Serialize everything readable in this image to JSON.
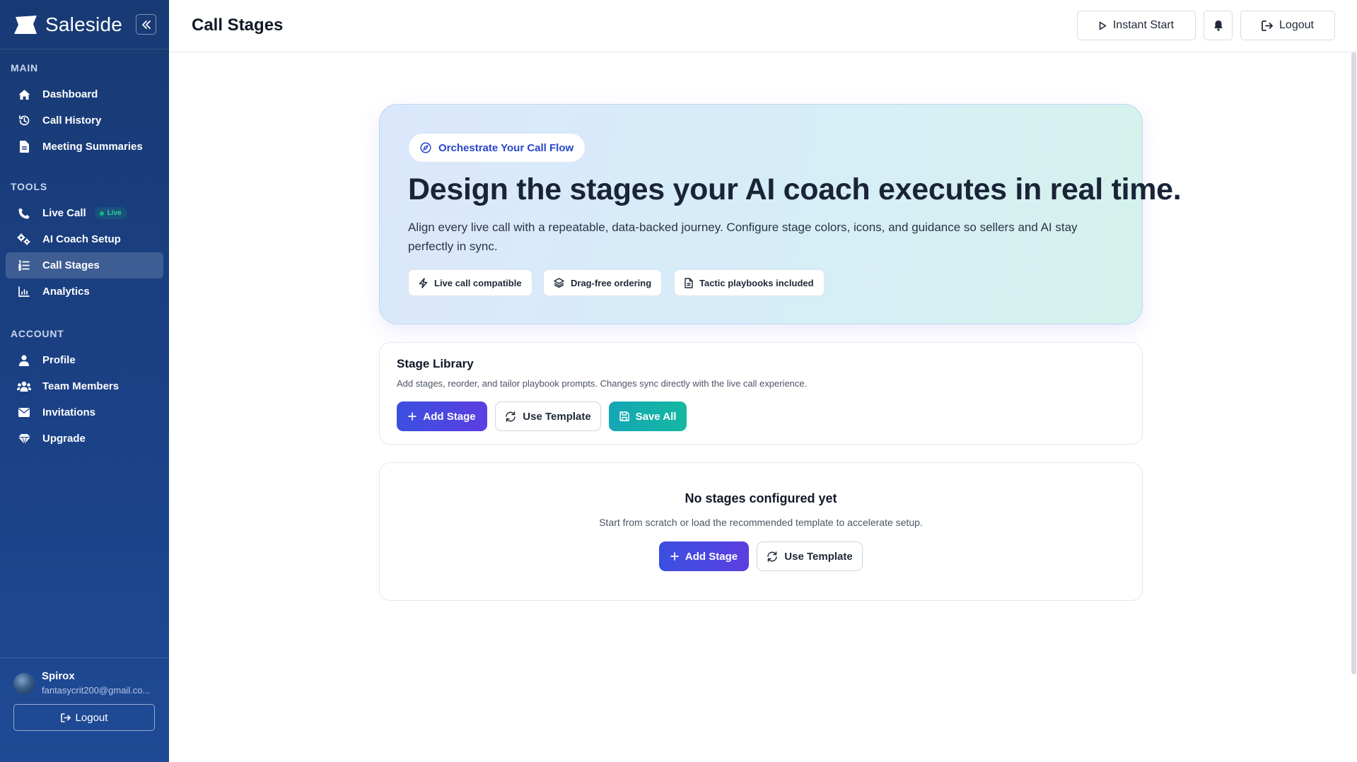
{
  "app": {
    "name": "Saleside"
  },
  "sidebar": {
    "sections": [
      {
        "label": "MAIN",
        "items": [
          {
            "label": "Dashboard",
            "icon": "home-icon"
          },
          {
            "label": "Call History",
            "icon": "history-icon"
          },
          {
            "label": "Meeting Summaries",
            "icon": "document-icon"
          }
        ]
      },
      {
        "label": "TOOLS",
        "items": [
          {
            "label": "Live Call",
            "icon": "phone-icon",
            "badge": "Live"
          },
          {
            "label": "AI Coach Setup",
            "icon": "gears-icon"
          },
          {
            "label": "Call Stages",
            "icon": "list-ordered-icon",
            "active": true
          },
          {
            "label": "Analytics",
            "icon": "chart-icon"
          }
        ]
      },
      {
        "label": "ACCOUNT",
        "items": [
          {
            "label": "Profile",
            "icon": "user-icon"
          },
          {
            "label": "Team Members",
            "icon": "users-icon"
          },
          {
            "label": "Invitations",
            "icon": "envelope-icon"
          },
          {
            "label": "Upgrade",
            "icon": "gem-icon"
          }
        ]
      }
    ],
    "user": {
      "name": "Spirox",
      "email": "fantasycrit200@gmail.co..."
    },
    "logout_label": "Logout"
  },
  "header": {
    "title": "Call Stages",
    "instant_start_label": "Instant Start",
    "logout_label": "Logout"
  },
  "hero": {
    "pill": "Orchestrate Your Call Flow",
    "title": "Design the stages your AI coach executes in real time.",
    "description": "Align every live call with a repeatable, data-backed journey. Configure stage colors, icons, and guidance so sellers and AI stay perfectly in sync.",
    "chips": [
      "Live call compatible",
      "Drag-free ordering",
      "Tactic playbooks included"
    ]
  },
  "library": {
    "title": "Stage Library",
    "subtitle": "Add stages, reorder, and tailor playbook prompts. Changes sync directly with the live call experience.",
    "add_label": "Add Stage",
    "template_label": "Use Template",
    "save_label": "Save All"
  },
  "empty": {
    "title": "No stages configured yet",
    "subtitle": "Start from scratch or load the recommended template to accelerate setup.",
    "add_label": "Add Stage",
    "template_label": "Use Template"
  },
  "colors": {
    "sidebar": "#1b4186",
    "primary": "#3b4fe0",
    "teal": "#14b8a6",
    "live": "#10b981"
  }
}
